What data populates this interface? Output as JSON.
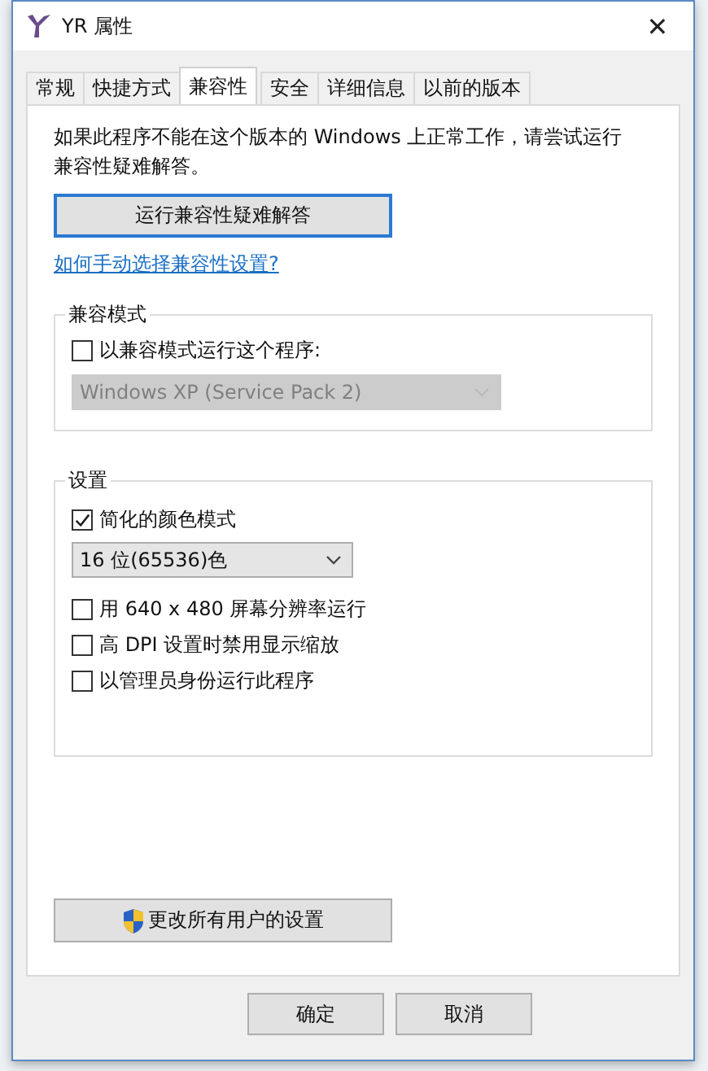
{
  "window": {
    "title": "YR 属性",
    "close": "✕"
  },
  "tabs": [
    {
      "label": "常规",
      "selected": false
    },
    {
      "label": "快捷方式",
      "selected": false
    },
    {
      "label": "兼容性",
      "selected": true
    },
    {
      "label": "安全",
      "selected": false
    },
    {
      "label": "详细信息",
      "selected": false
    },
    {
      "label": "以前的版本",
      "selected": false
    }
  ],
  "intro": "如果此程序不能在这个版本的 Windows 上正常工作，请尝试运行兼容性疑难解答。",
  "troubleshoot_button": "运行兼容性疑难解答",
  "help_link": "如何手动选择兼容性设置?",
  "compat_mode": {
    "title": "兼容模式",
    "checkbox": {
      "label": "以兼容模式运行这个程序:",
      "checked": false
    },
    "dropdown": {
      "value": "Windows XP (Service Pack 2)",
      "disabled": true
    }
  },
  "settings": {
    "title": "设置",
    "items": [
      {
        "kind": "checkbox",
        "label": "简化的颜色模式",
        "checked": true
      },
      {
        "kind": "dropdown",
        "value": "16 位(65536)色",
        "disabled": false
      },
      {
        "kind": "checkbox",
        "label": "用 640 x 480 屏幕分辨率运行",
        "checked": false
      },
      {
        "kind": "checkbox",
        "label": "高 DPI 设置时禁用显示缩放",
        "checked": false
      },
      {
        "kind": "checkbox",
        "label": "以管理员身份运行此程序",
        "checked": false
      }
    ]
  },
  "all_users_button": "更改所有用户的设置",
  "buttons": [
    "确定",
    "取消"
  ]
}
